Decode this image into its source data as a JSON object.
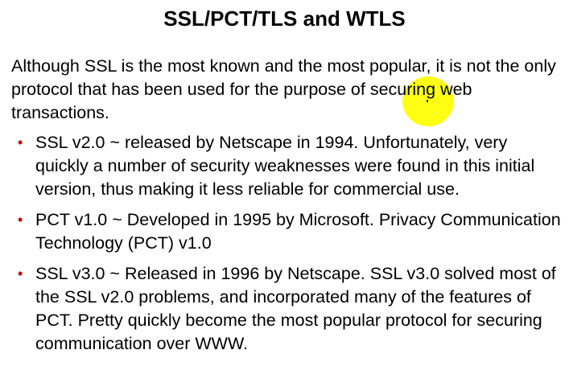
{
  "slide": {
    "title": "SSL/PCT/TLS and WTLS",
    "intro": "Although SSL is the most known and the most popular, it is not the only protocol that has been used for the purpose of securing web transactions.",
    "bullet_symbol": "•",
    "bullets": [
      "SSL v2.0 ~ released by Netscape in 1994. Unfortunately, very quickly a number of security weaknesses were found in this initial version, thus making it less reliable for commercial use.",
      "PCT v1.0 ~ Developed in 1995 by Microsoft. Privacy Communication Technology (PCT) v1.0",
      "SSL v3.0 ~ Released in 1996 by Netscape. SSL v3.0 solved most of the SSL v2.0 problems, and incorporated many of the features of PCT. Pretty quickly become the most popular protocol for securing communication over WWW."
    ]
  },
  "colors": {
    "bullet": "#cc0000",
    "pointer_highlight": "#ffff00",
    "text": "#000000",
    "background": "#ffffff"
  }
}
